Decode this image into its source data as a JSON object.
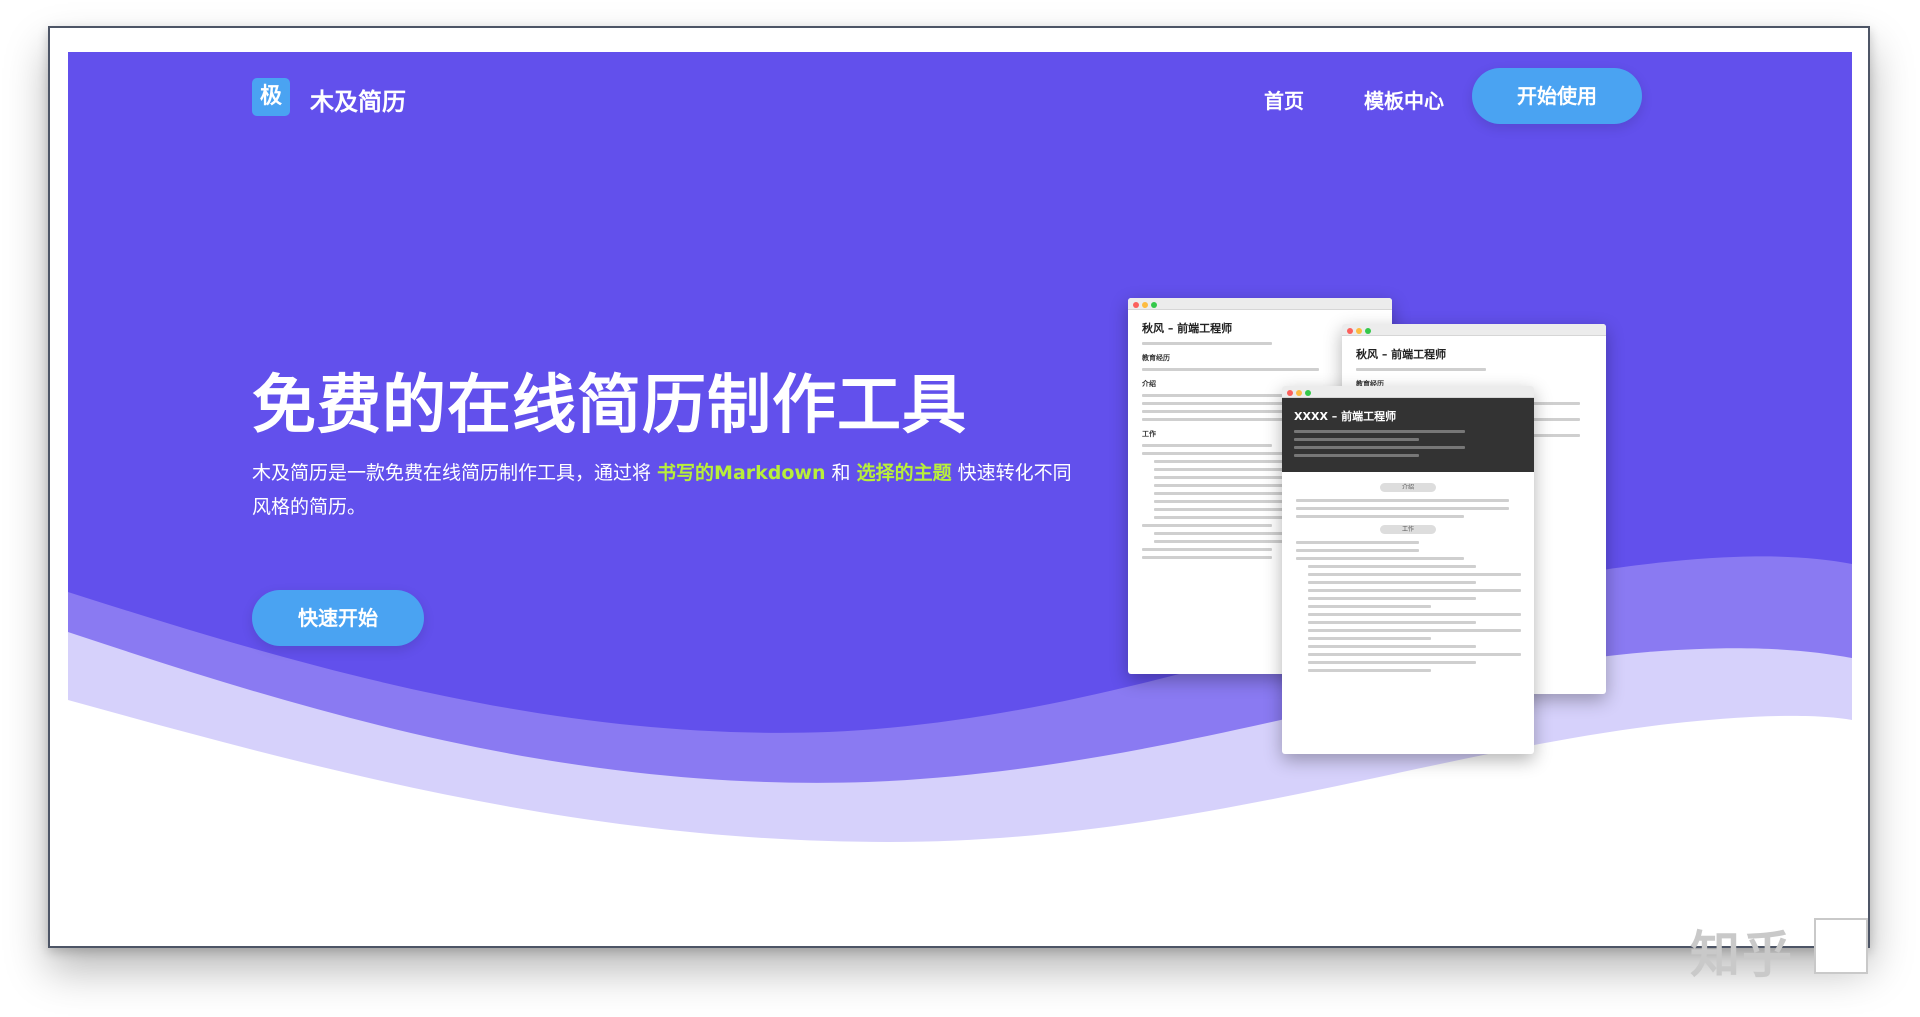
{
  "brand": {
    "logo_glyph": "极",
    "name": "木及简历"
  },
  "nav": {
    "home": "首页",
    "templates": "模板中心",
    "cta": "开始使用"
  },
  "hero": {
    "title": "免费的在线简历制作工具",
    "desc_prefix": "木及简历是一款免费在线简历制作工具，通过将 ",
    "highlight_1": "书写的Markdown",
    "desc_mid": " 和 ",
    "highlight_2": "选择的主题",
    "desc_suffix": " 快速转化不同风格的简历。",
    "cta": "快速开始"
  },
  "previews": {
    "win1": {
      "title": "秋风 – 前端工程师",
      "sections": [
        "教育经历",
        "介绍",
        "工作"
      ]
    },
    "win2": {
      "title": "秋风 – 前端工程师",
      "sections": [
        "教育经历"
      ]
    },
    "win3": {
      "title": "XXXX – 前端工程师",
      "pills": [
        "介绍",
        "工作"
      ]
    }
  },
  "watermark": "知乎",
  "colors": {
    "hero_bg": "#6250ec",
    "button": "#4aa3f2",
    "highlight": "#b8ef3a",
    "wave_mid": "#8a7af2",
    "wave_light": "#d6d1fb"
  }
}
